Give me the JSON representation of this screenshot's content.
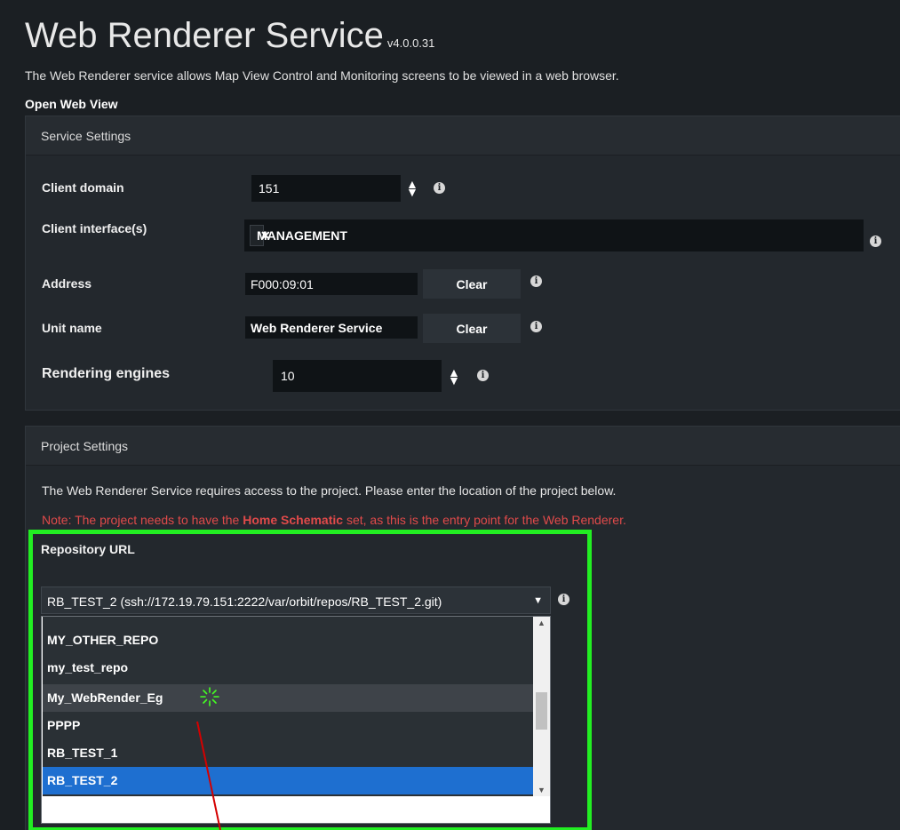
{
  "header": {
    "title": "Web Renderer Service",
    "version": "v4.0.0.31",
    "description": "The Web Renderer service allows Map View Control and Monitoring screens to be viewed in a web browser.",
    "open_link": "Open Web View"
  },
  "service_settings": {
    "title": "Service Settings",
    "client_domain": {
      "label": "Client domain",
      "value": "151"
    },
    "client_interfaces": {
      "label": "Client interface(s)",
      "chip": "MANAGEMENT",
      "chip_remove": "✕"
    },
    "address": {
      "label": "Address",
      "value": "F000:09:01",
      "button": "Clear"
    },
    "unit_name": {
      "label": "Unit name",
      "value": "Web Renderer Service",
      "button": "Clear"
    },
    "rendering_engines": {
      "label": "Rendering engines",
      "value": "10"
    }
  },
  "project_settings": {
    "title": "Project Settings",
    "description": "The Web Renderer Service requires access to the project. Please enter the location of the project below.",
    "note_prefix": "Note: The project needs to have the ",
    "note_bold": "Home Schematic",
    "note_suffix": " set, as this is the entry point for the Web Renderer.",
    "repository": {
      "label": "Repository URL",
      "selected": "RB_TEST_2 (ssh://172.19.79.151:2222/var/orbit/repos/RB_TEST_2.git)",
      "options": [
        "MY_OTHER_REPO",
        "my_test_repo",
        "My_WebRender_Eg",
        "PPPP",
        "RB_TEST_1",
        "RB_TEST_2"
      ],
      "hovered_option": "My_WebRender_Eg",
      "selected_option": "RB_TEST_2"
    }
  },
  "icons": {
    "info": "info-icon",
    "spinner": "up-down-spinner-icon",
    "dropdown": "chevron-down-icon",
    "busy": "loading-spinner-icon"
  },
  "colors": {
    "background": "#1b1f23",
    "panel": "#23282d",
    "field": "#0f1316",
    "note": "#e04a4a",
    "selection": "#1e6fd0",
    "highlight_box": "#22ee22",
    "annotation_line": "#d40000"
  }
}
